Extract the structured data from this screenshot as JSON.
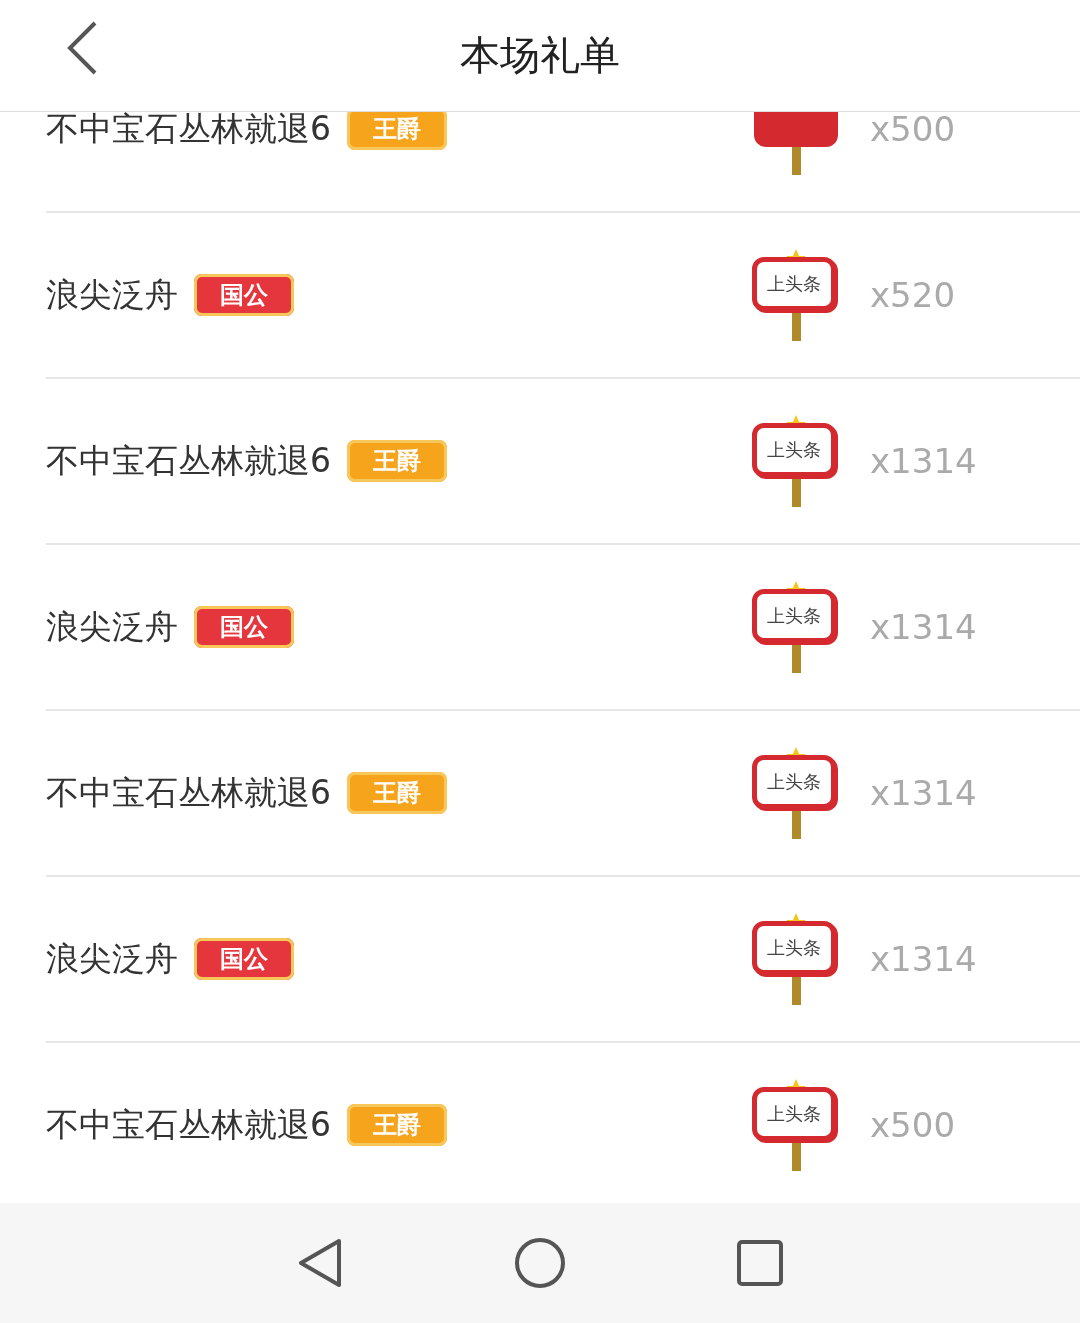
{
  "header": {
    "title": "本场礼单"
  },
  "rows": [
    {
      "name": "不中宝石丛林就退6",
      "badge": {
        "kind": "gold",
        "label": "王爵"
      },
      "count": "x500"
    },
    {
      "name": "浪尖泛舟",
      "badge": {
        "kind": "red",
        "label": "国公"
      },
      "sign_text": "上头条",
      "count": "x520"
    },
    {
      "name": "不中宝石丛林就退6",
      "badge": {
        "kind": "gold",
        "label": "王爵"
      },
      "sign_text": "上头条",
      "count": "x1314"
    },
    {
      "name": "浪尖泛舟",
      "badge": {
        "kind": "red",
        "label": "国公"
      },
      "sign_text": "上头条",
      "count": "x1314"
    },
    {
      "name": "不中宝石丛林就退6",
      "badge": {
        "kind": "gold",
        "label": "王爵"
      },
      "sign_text": "上头条",
      "count": "x1314"
    },
    {
      "name": "浪尖泛舟",
      "badge": {
        "kind": "red",
        "label": "国公"
      },
      "sign_text": "上头条",
      "count": "x1314"
    },
    {
      "name": "不中宝石丛林就退6",
      "badge": {
        "kind": "gold",
        "label": "王爵"
      },
      "sign_text": "上头条",
      "count": "x500"
    }
  ]
}
